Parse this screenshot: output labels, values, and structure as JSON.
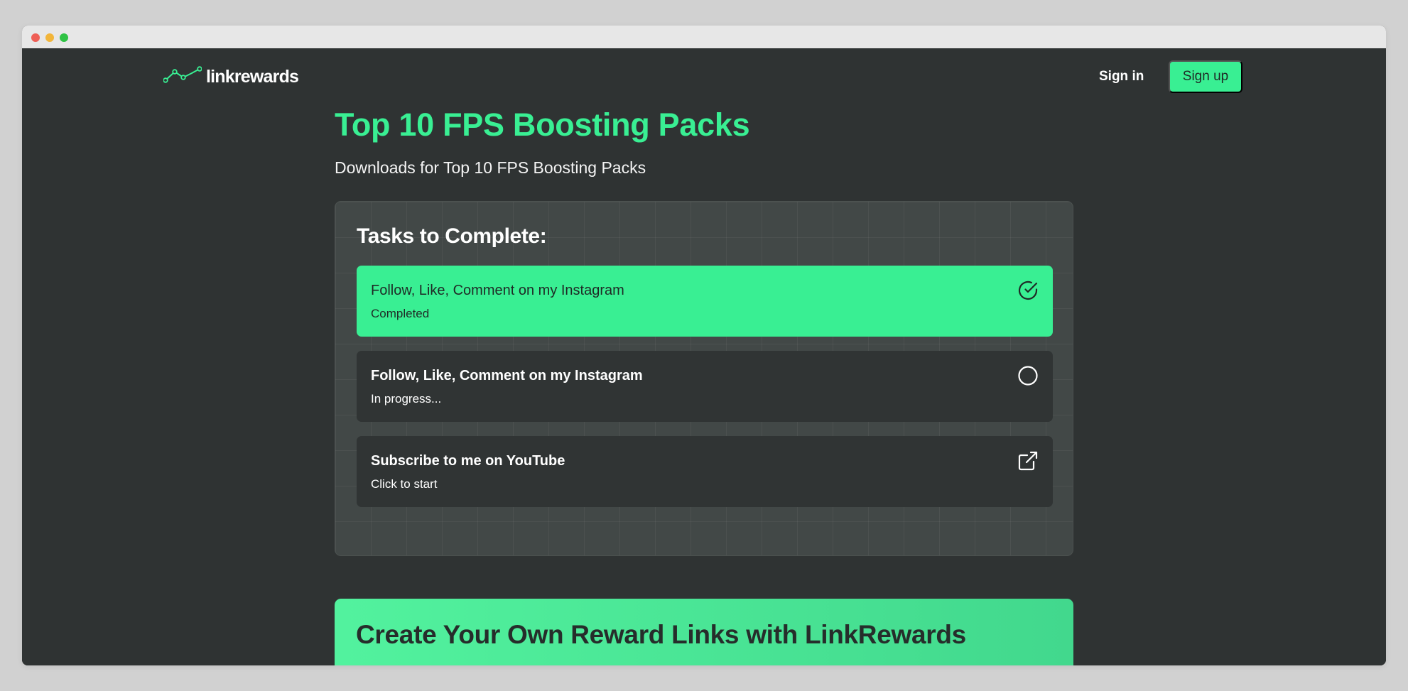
{
  "brand": {
    "name": "linkrewards",
    "accent": "#39ef93"
  },
  "nav": {
    "signin_label": "Sign in",
    "signup_label": "Sign up"
  },
  "page": {
    "title": "Top 10 FPS Boosting Packs",
    "subtitle": "Downloads for Top 10 FPS Boosting Packs"
  },
  "tasks_panel": {
    "heading": "Tasks to Complete:",
    "tasks": [
      {
        "title": "Follow, Like, Comment on my Instagram",
        "status": "Completed",
        "icon": "check-circle-icon"
      },
      {
        "title": "Follow, Like, Comment on my Instagram",
        "status": "In progress...",
        "icon": "circle-icon"
      },
      {
        "title": "Subscribe to me on YouTube",
        "status": "Click to start",
        "icon": "external-link-icon"
      }
    ]
  },
  "cta": {
    "heading": "Create Your Own Reward Links with LinkRewards"
  }
}
